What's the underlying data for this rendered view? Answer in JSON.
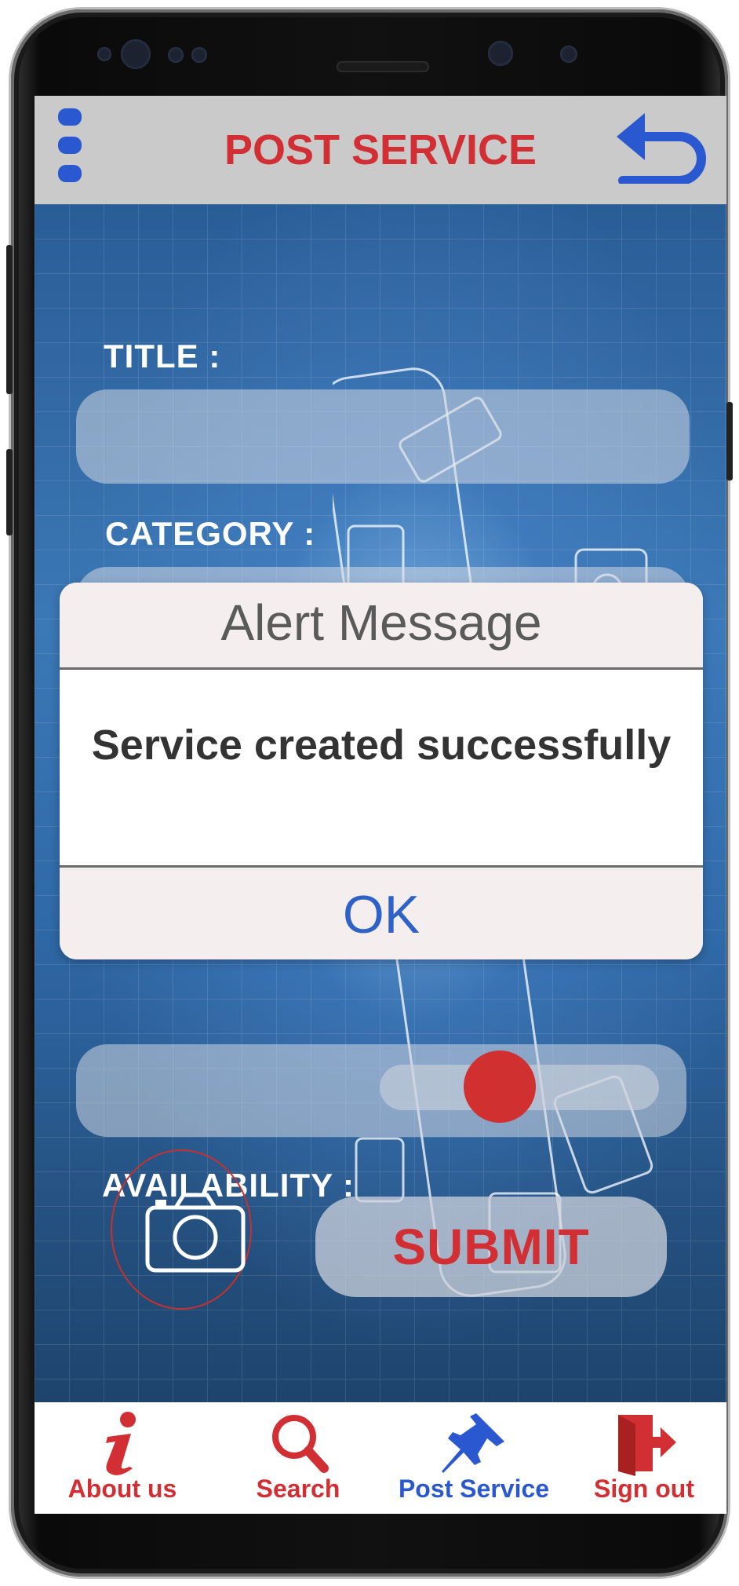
{
  "header": {
    "title": "POST SERVICE"
  },
  "form": {
    "title_label": "TITLE :",
    "title_value": "",
    "category_label": "CATEGORY :",
    "category_value": "",
    "availability_label": "AVAILABILITY :",
    "availability_on": true,
    "submit_label": "SUBMIT"
  },
  "dialog": {
    "title": "Alert Message",
    "message": "Service created successfully",
    "ok_label": "OK"
  },
  "nav": {
    "items": [
      {
        "label": "About us",
        "icon": "info-icon",
        "active": false
      },
      {
        "label": "Search",
        "icon": "search-icon",
        "active": false
      },
      {
        "label": "Post Service",
        "icon": "pushpin-icon",
        "active": true
      },
      {
        "label": "Sign out",
        "icon": "sign-out-icon",
        "active": false
      }
    ]
  },
  "colors": {
    "accent_red": "#d12f33",
    "accent_blue": "#2a58d0",
    "header_bg": "#cacaca"
  }
}
